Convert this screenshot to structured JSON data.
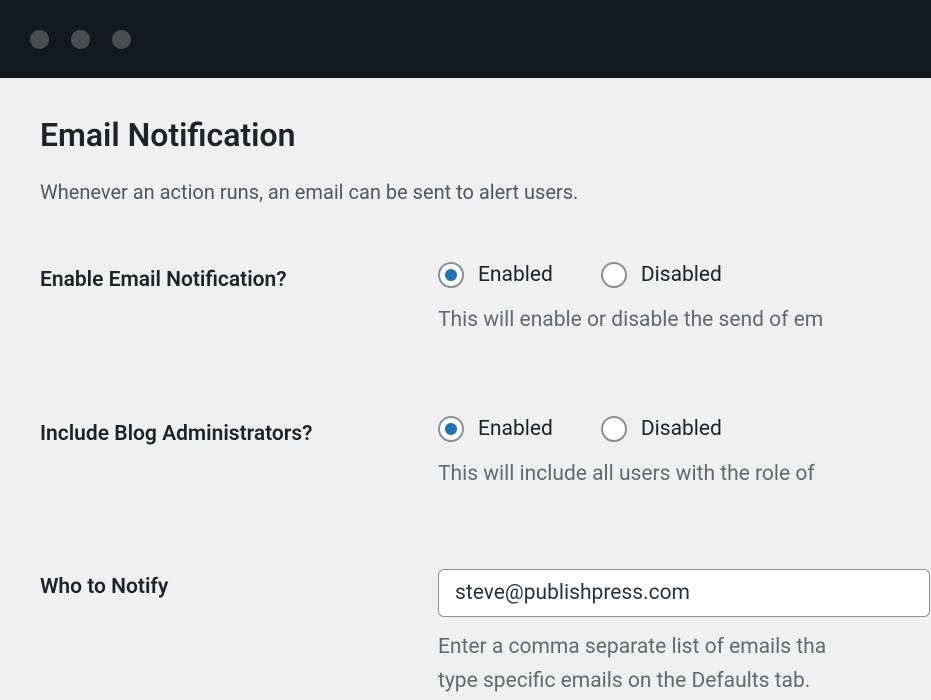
{
  "page": {
    "title": "Email Notification",
    "description": "Whenever an action runs, an email can be sent to alert users."
  },
  "settings": {
    "enable_email": {
      "label": "Enable Email Notification?",
      "options": {
        "enabled": "Enabled",
        "disabled": "Disabled"
      },
      "selected": "enabled",
      "help": "This will enable or disable the send of em"
    },
    "include_admins": {
      "label": "Include Blog Administrators?",
      "options": {
        "enabled": "Enabled",
        "disabled": "Disabled"
      },
      "selected": "enabled",
      "help": "This will include all users with the role of"
    },
    "who_to_notify": {
      "label": "Who to Notify",
      "value": "steve@publishpress.com",
      "help_line1": "Enter a comma separate list of emails tha",
      "help_line2": "type specific emails on the Defaults tab."
    }
  }
}
